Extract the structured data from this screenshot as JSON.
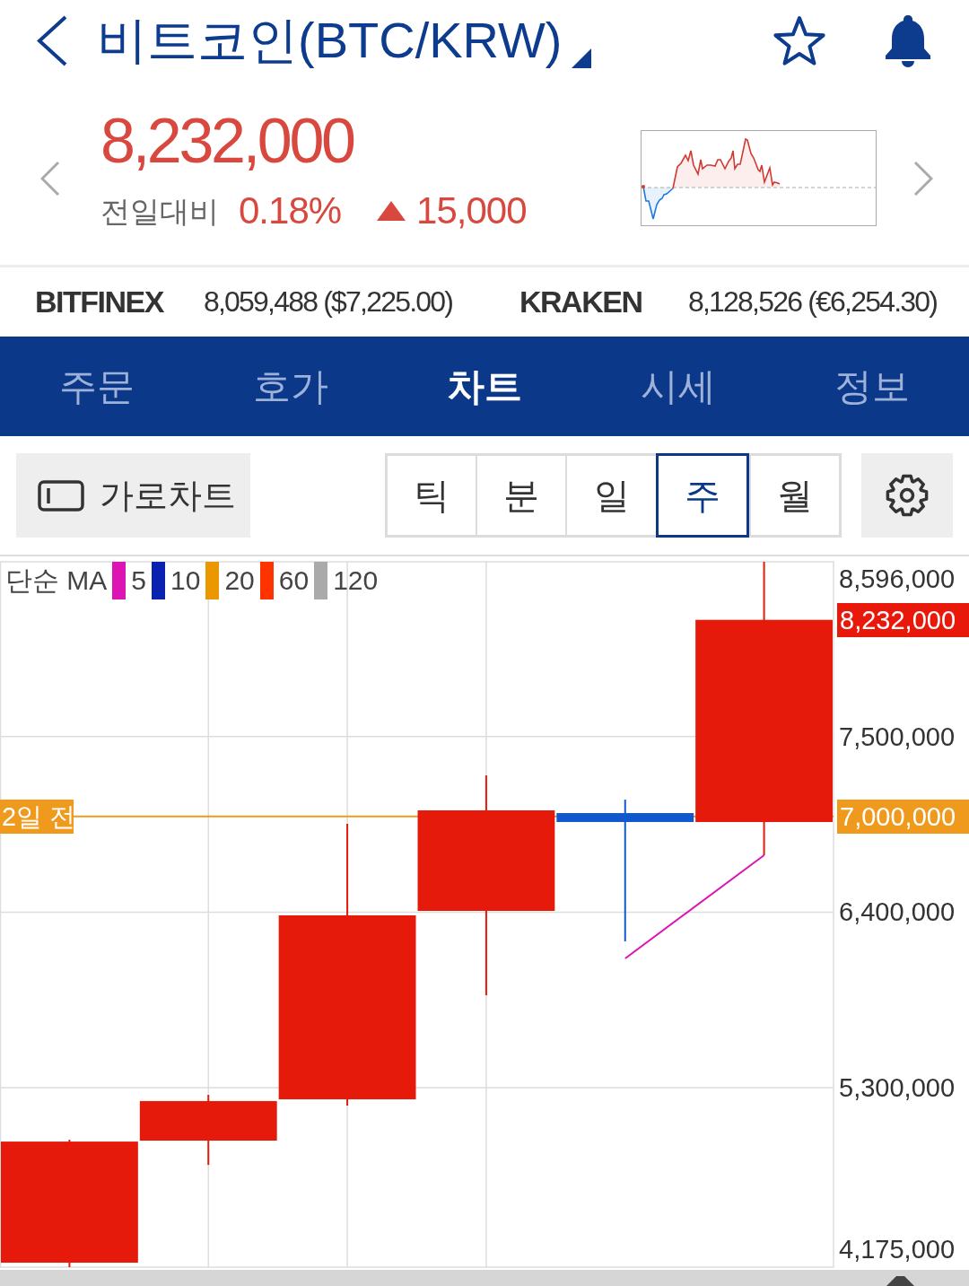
{
  "header": {
    "title": "비트코인(BTC/KRW)"
  },
  "quote": {
    "price": "8,232,000",
    "change_label": "전일대비",
    "change_rate": "0.18%",
    "rising": true,
    "change_amount": "15,000"
  },
  "exchanges": [
    {
      "name": "BITFINEX",
      "price": "8,059,488 ($7,225.00)"
    },
    {
      "name": "KRAKEN",
      "price": "8,128,526 (€6,254.30)"
    }
  ],
  "tabs": [
    {
      "label": "주문",
      "selected": false
    },
    {
      "label": "호가",
      "selected": false
    },
    {
      "label": "차트",
      "selected": true
    },
    {
      "label": "시세",
      "selected": false
    },
    {
      "label": "정보",
      "selected": false
    }
  ],
  "toolbar": {
    "landscape_button": "가로차트",
    "periods": [
      {
        "label": "틱",
        "selected": false
      },
      {
        "label": "분",
        "selected": false
      },
      {
        "label": "일",
        "selected": false
      },
      {
        "label": "주",
        "selected": true
      },
      {
        "label": "월",
        "selected": false
      }
    ]
  },
  "chart": {
    "legend": {
      "title": "단순 MA",
      "items": [
        {
          "label": "5",
          "color": "#dc14b4"
        },
        {
          "label": "10",
          "color": "#0b22b0"
        },
        {
          "label": "20",
          "color": "#eb9800"
        },
        {
          "label": "60",
          "color": "#ff3300"
        },
        {
          "label": "120",
          "color": "#aaaaaa"
        }
      ]
    },
    "y_axis": [
      "8,596,000",
      "7,500,000",
      "6,400,000",
      "5,300,000",
      "4,175,000"
    ],
    "current_price_tag": "8,232,000",
    "reference": {
      "label": "2일 전",
      "value": "7,000,000"
    }
  }
}
